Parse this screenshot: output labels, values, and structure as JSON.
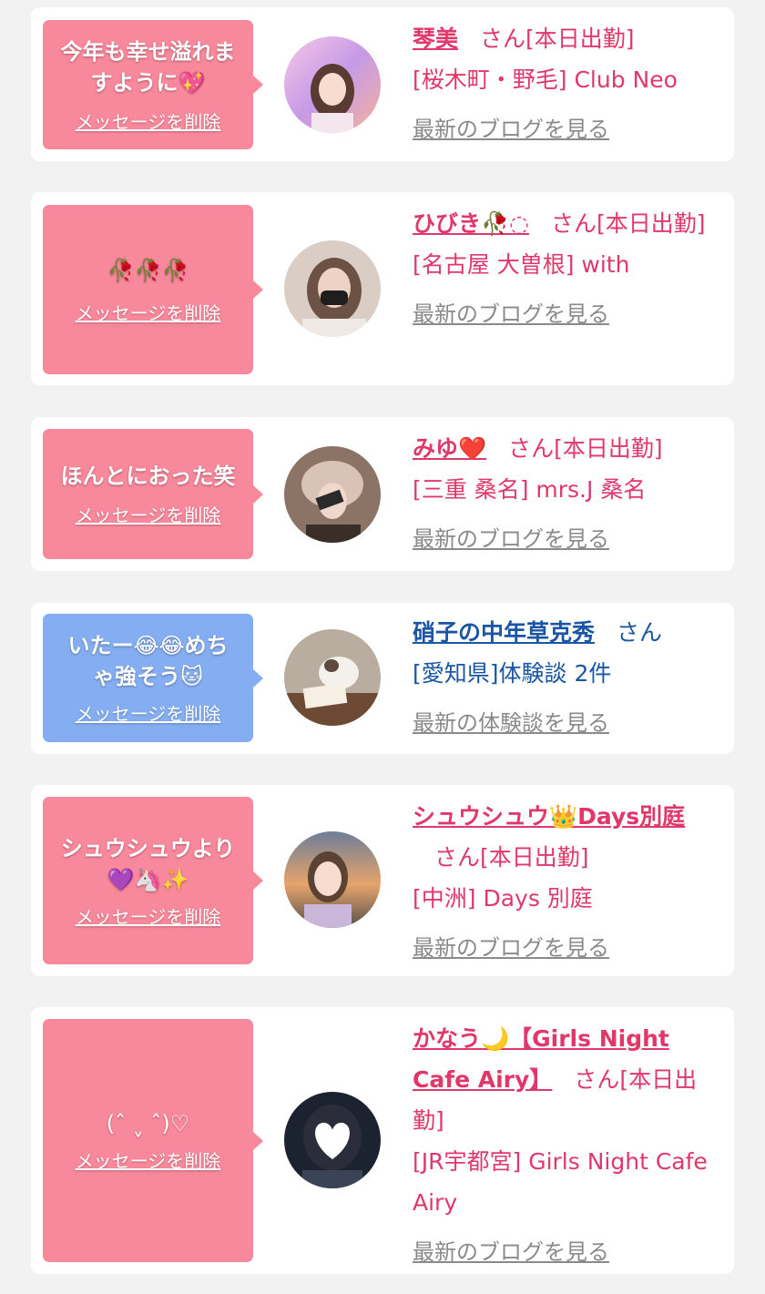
{
  "common": {
    "delete_label": "メッセージを削除",
    "san": "さん"
  },
  "cards": [
    {
      "message": "今年も幸せ溢れますように💖",
      "name": "琴美",
      "status": "[本日出勤]",
      "shop": "[桜木町・野毛] Club Neo",
      "link": "最新のブログを見る",
      "bubble_color": "#f8889b",
      "text_color": "#e0386b"
    },
    {
      "message": "🥀🥀🥀",
      "name": "ひびき🥀◌",
      "status": "[本日出勤]",
      "shop": "[名古屋 大曽根] with",
      "link": "最新のブログを見る",
      "bubble_color": "#f8889b",
      "text_color": "#e0386b"
    },
    {
      "message": "ほんとにおった笑",
      "name": "みゆ❤️",
      "status": "[本日出勤]",
      "shop": "[三重 桑名] mrs.J 桑名",
      "link": "最新のブログを見る",
      "bubble_color": "#f8889b",
      "text_color": "#e0386b"
    },
    {
      "message": "いたー😂😂めちゃ強そう🐱",
      "name": "硝子の中年草克秀",
      "status": "",
      "shop": "[愛知県]体験談 2件",
      "link": "最新の体験談を見る",
      "bubble_color": "#84aef1",
      "text_color": "#1a56a3"
    },
    {
      "message": "シュウシュウより💜🦄✨",
      "name": "シュウシュウ👑Days別庭",
      "status": "[本日出勤]",
      "shop": "[中洲] Days 別庭",
      "link": "最新のブログを見る",
      "bubble_color": "#f8889b",
      "text_color": "#e0386b"
    },
    {
      "message": "(ˆ ˬ ˆ)♡",
      "name": "かなう🌙【Girls Night Cafe Airy】",
      "status": "[本日出勤]",
      "shop": "[JR宇都宮] Girls Night Cafe Airy",
      "link": "最新のブログを見る",
      "bubble_color": "#f8889b",
      "text_color": "#e0386b"
    }
  ]
}
